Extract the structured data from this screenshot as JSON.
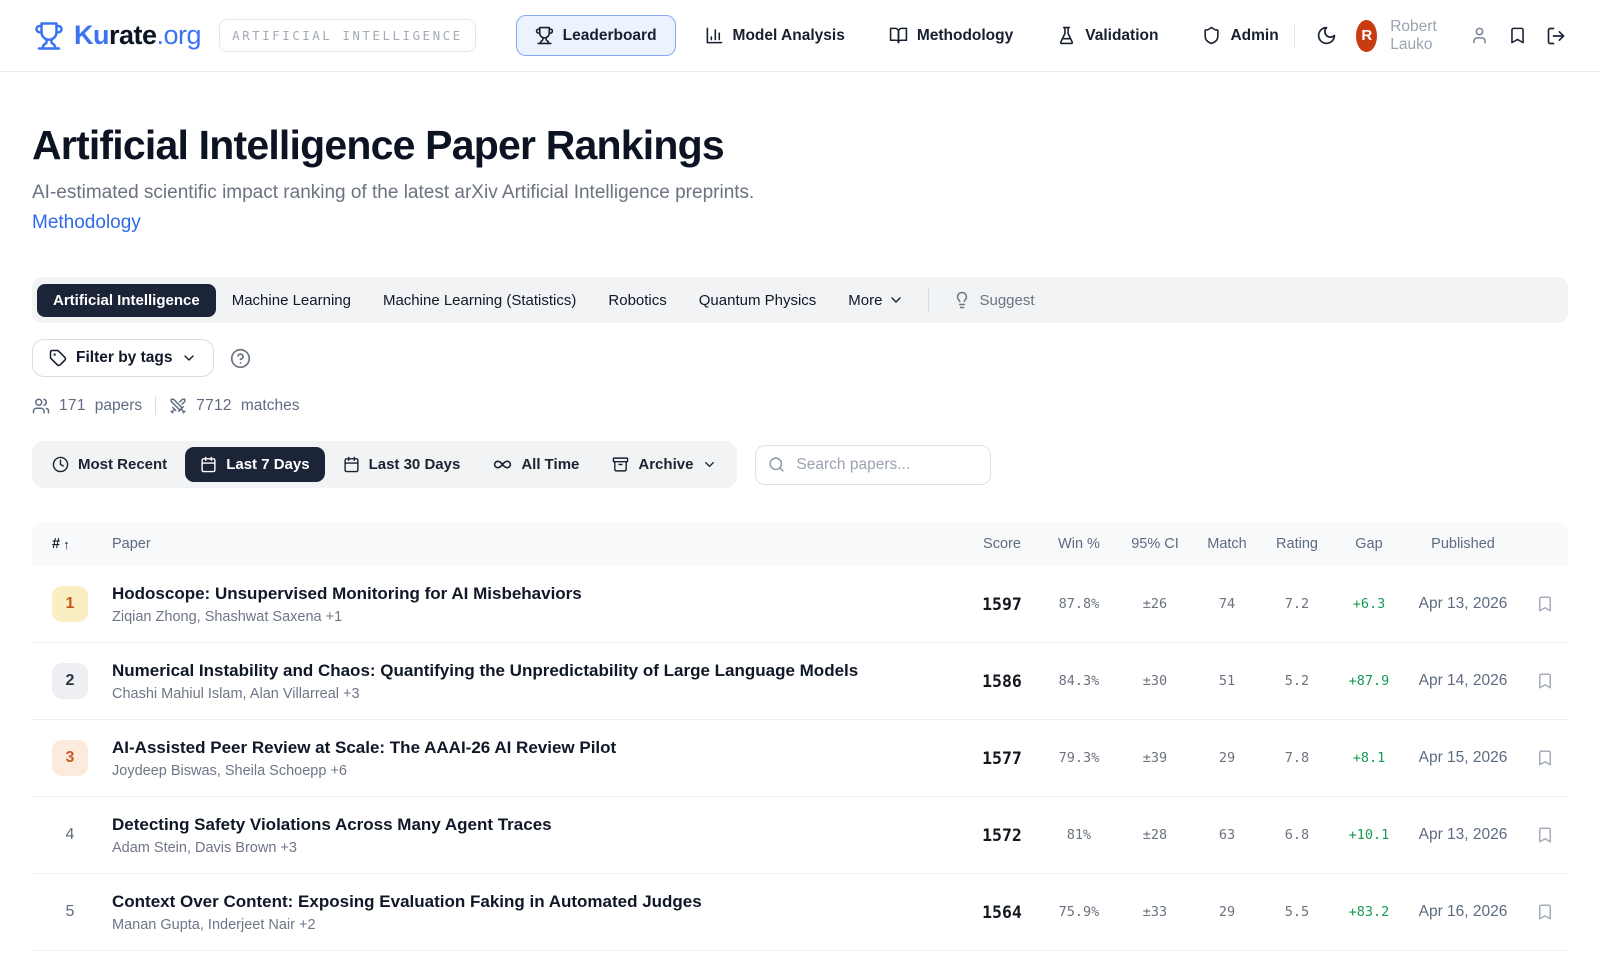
{
  "header": {
    "brand": {
      "part_blue": "Ku",
      "part_dark": "rate",
      "part_org": ".org"
    },
    "category_badge": "ARTIFICIAL INTELLIGENCE",
    "nav": {
      "leaderboard": "Leaderboard",
      "model_analysis": "Model Analysis",
      "methodology": "Methodology",
      "validation": "Validation",
      "admin": "Admin"
    },
    "user": {
      "avatar_initial": "R",
      "name": "Robert Lauko"
    }
  },
  "hero": {
    "title": "Artificial Intelligence Paper Rankings",
    "subtitle": "AI-estimated scientific impact ranking of the latest arXiv Artificial Intelligence preprints.",
    "methodology_link": "Methodology"
  },
  "category_tabs": {
    "items": [
      {
        "label": "Artificial Intelligence",
        "active": true
      },
      {
        "label": "Machine Learning",
        "active": false
      },
      {
        "label": "Machine Learning (Statistics)",
        "active": false
      },
      {
        "label": "Robotics",
        "active": false
      },
      {
        "label": "Quantum Physics",
        "active": false
      },
      {
        "label": "More",
        "active": false
      }
    ],
    "suggest_label": "Suggest"
  },
  "filters": {
    "filter_by_tags_label": "Filter by tags",
    "stats": {
      "papers_count": "171",
      "papers_label": "papers",
      "matches_count": "7712",
      "matches_label": "matches"
    },
    "time": {
      "most_recent": "Most Recent",
      "last_7_days": "Last 7 Days",
      "last_30_days": "Last 30 Days",
      "all_time": "All Time",
      "archive": "Archive"
    },
    "active_time_filter": "Last 7 Days",
    "search_placeholder": "Search papers..."
  },
  "table": {
    "columns": {
      "rank": "#",
      "sort_indicator": "↑",
      "paper": "Paper",
      "score": "Score",
      "win": "Win %",
      "ci": "95% CI",
      "match": "Match",
      "rating": "Rating",
      "gap": "Gap",
      "published": "Published"
    },
    "rows": [
      {
        "rank": "1",
        "title": "Hodoscope: Unsupervised Monitoring for AI Misbehaviors",
        "authors": "Ziqian Zhong, Shashwat Saxena +1",
        "score": "1597",
        "win": "87.8%",
        "ci": "±26",
        "match": "74",
        "rating": "7.2",
        "gap": "+6.3",
        "published": "Apr 13, 2026"
      },
      {
        "rank": "2",
        "title": "Numerical Instability and Chaos: Quantifying the Unpredictability of Large Language Models",
        "authors": "Chashi Mahiul Islam, Alan Villarreal +3",
        "score": "1586",
        "win": "84.3%",
        "ci": "±30",
        "match": "51",
        "rating": "5.2",
        "gap": "+87.9",
        "published": "Apr 14, 2026"
      },
      {
        "rank": "3",
        "title": "AI-Assisted Peer Review at Scale: The AAAI-26 AI Review Pilot",
        "authors": "Joydeep Biswas, Sheila Schoepp +6",
        "score": "1577",
        "win": "79.3%",
        "ci": "±39",
        "match": "29",
        "rating": "7.8",
        "gap": "+8.1",
        "published": "Apr 15, 2026"
      },
      {
        "rank": "4",
        "title": "Detecting Safety Violations Across Many Agent Traces",
        "authors": "Adam Stein, Davis Brown +3",
        "score": "1572",
        "win": "81%",
        "ci": "±28",
        "match": "63",
        "rating": "6.8",
        "gap": "+10.1",
        "published": "Apr 13, 2026"
      },
      {
        "rank": "5",
        "title": "Context Over Content: Exposing Evaluation Faking in Automated Judges",
        "authors": "Manan Gupta, Inderjeet Nair +2",
        "score": "1564",
        "win": "75.9%",
        "ci": "±33",
        "match": "29",
        "rating": "5.5",
        "gap": "+83.2",
        "published": "Apr 16, 2026"
      }
    ]
  },
  "colors": {
    "accent_blue": "#3b74f3",
    "link_blue": "#2f6ae8",
    "active_navy": "#1b2537",
    "gap_green": "#169a53",
    "rank1_bg": "#fbeec3",
    "rank1_text": "#bf5b1d",
    "rank3_bg": "#fcebdc",
    "rank3_text": "#cf5a28",
    "avatar_red": "#c93c12"
  }
}
